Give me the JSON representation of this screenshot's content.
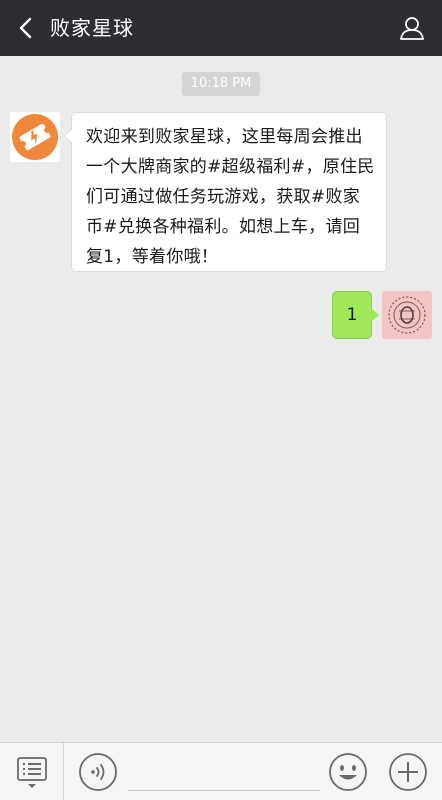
{
  "header": {
    "title": "败家星球",
    "back_icon": "chevron-left-icon",
    "profile_icon": "person-outline-icon",
    "background": "#2e2e32"
  },
  "chat": {
    "timestamp": "10:18 PM",
    "messages": [
      {
        "side": "left",
        "text": "欢迎来到败家星球，这里每周会推出一个大牌商家的#超级福利#，原住民们可通过做任务玩游戏，获取#败家币#兑换各种福利。如想上车，请回复1，等着你哦！",
        "avatar_icon": "orange-ticket-logo-icon"
      },
      {
        "side": "right",
        "text": "1",
        "avatar_icon": "stamp-avatar-icon",
        "bubble_color": "#a0e75a"
      }
    ]
  },
  "input_bar": {
    "menu_icon": "list-menu-icon",
    "voice_icon": "voice-icon",
    "emoji_icon": "smile-icon",
    "plus_icon": "plus-icon",
    "input_value": ""
  },
  "colors": {
    "background": "#ebebeb",
    "accent_orange": "#f0873a"
  }
}
